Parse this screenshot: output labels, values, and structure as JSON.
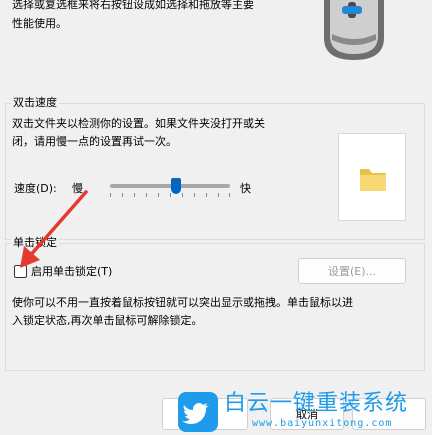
{
  "top_text": {
    "line1": "选择或复选框来将右按钮设成如选择和拖放等主要",
    "line2": "性能使用。"
  },
  "double_click": {
    "title": "双击速度",
    "desc_line1": "双击文件夹以检测你的设置。如果文件夹没打开或关",
    "desc_line2": "闭，请用慢一点的设置再试一次。",
    "speed_label": "速度(D):",
    "slow_label": "慢",
    "fast_label": "快",
    "slider_value": 0.55
  },
  "click_lock": {
    "title": "单击锁定",
    "checkbox_label": "启用单击锁定(T)",
    "checked": false,
    "settings_button": "设置(E)...",
    "desc_line1": "使你可以不用一直按着鼠标按钮就可以突出显示或拖拽。单击鼠标以进",
    "desc_line2": "入锁定状态,再次单击鼠标可解除锁定。"
  },
  "footer": {
    "cancel_label": "取消"
  },
  "watermark": {
    "title": "白云一键重装系统",
    "url": "www.baiyunxitong.com"
  },
  "colors": {
    "slider_thumb": "#0067c0",
    "arrow": "#e53a2f",
    "watermark_blue": "#1e9bea"
  }
}
